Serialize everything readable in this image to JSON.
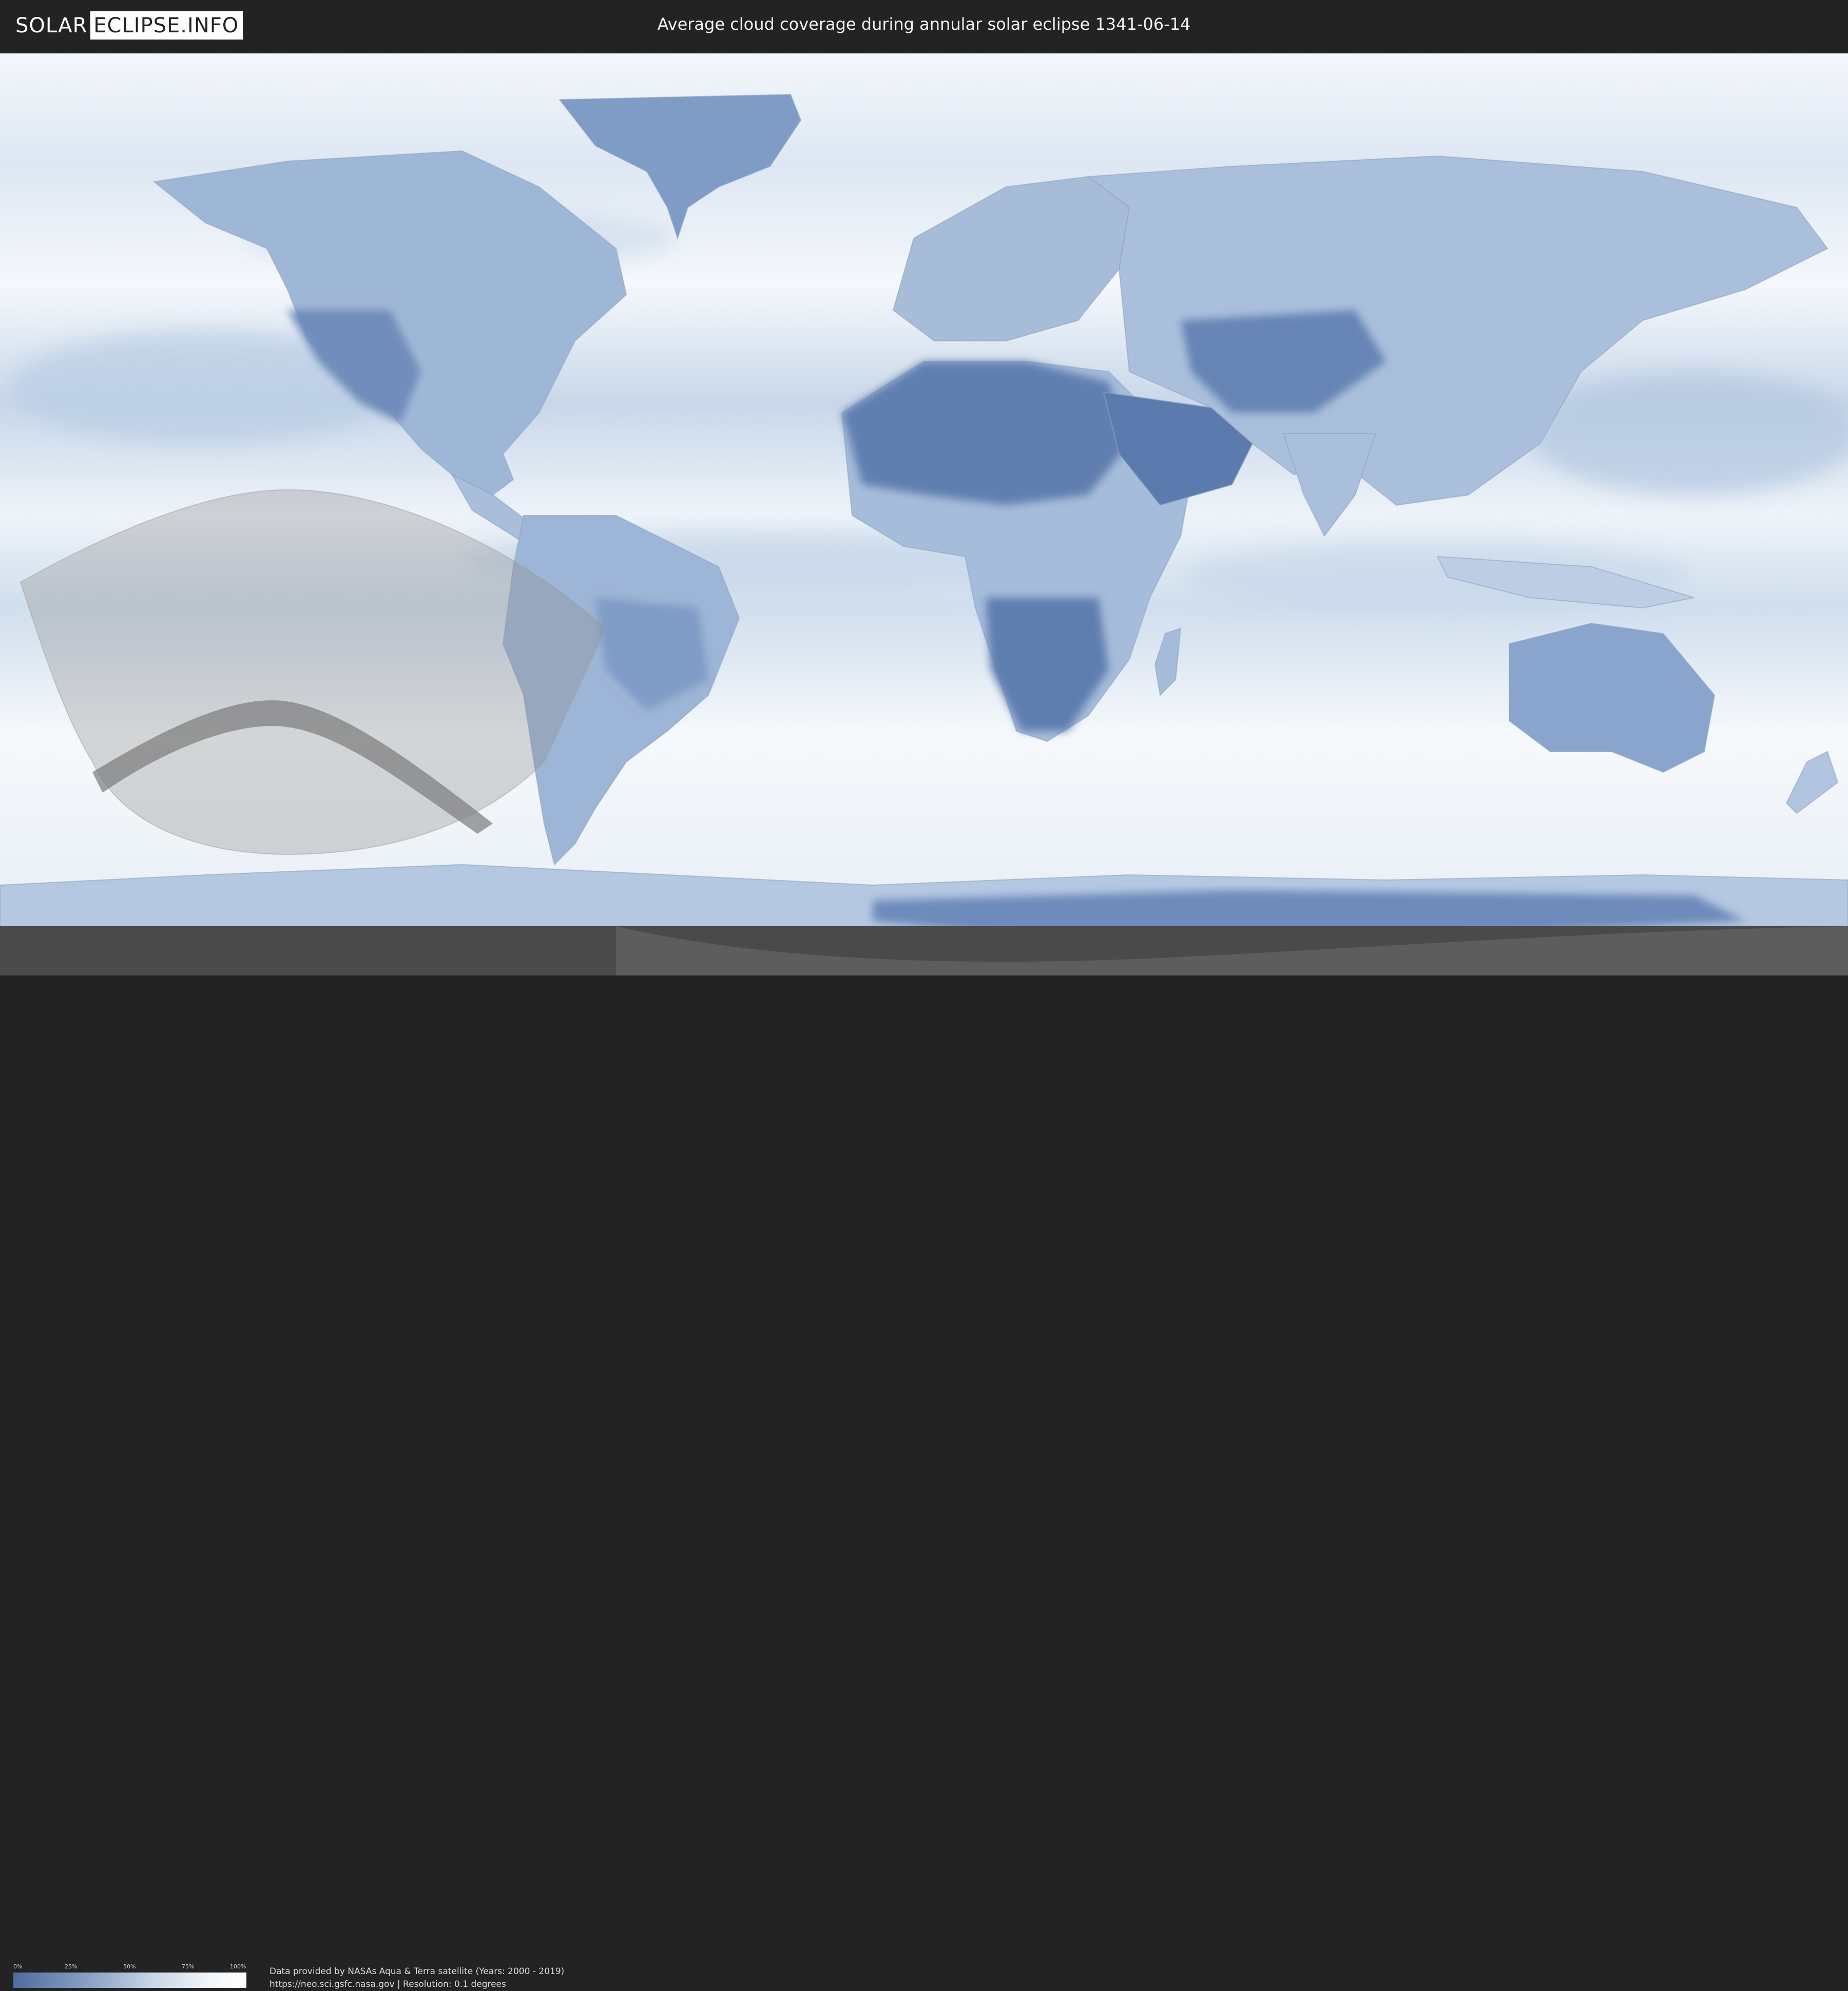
{
  "header": {
    "logo_left": "SOLAR",
    "logo_right": "ECLIPSE.INFO",
    "title": "Average cloud coverage during annular solar eclipse 1341-06-14"
  },
  "legend": {
    "ticks": [
      "0%",
      "25%",
      "50%",
      "75%",
      "100%"
    ],
    "gradient_colors": [
      "#4f6c9f",
      "#8ea6c8",
      "#c9d6e7",
      "#f3f6fa",
      "#ffffff"
    ]
  },
  "credits": {
    "line1": "Data provided by NASAs Aqua & Terra satellite (Years: 2000 - 2019)",
    "line2": "https://neo.sci.gsfc.nasa.gov | Resolution: 0.1 degrees"
  },
  "colors": {
    "background": "#232323",
    "clear_sky": "#4f6c9f",
    "cloud": "#ffffff",
    "eclipse_region": "#bdbdbd",
    "eclipse_path": "#8a8a8a"
  }
}
